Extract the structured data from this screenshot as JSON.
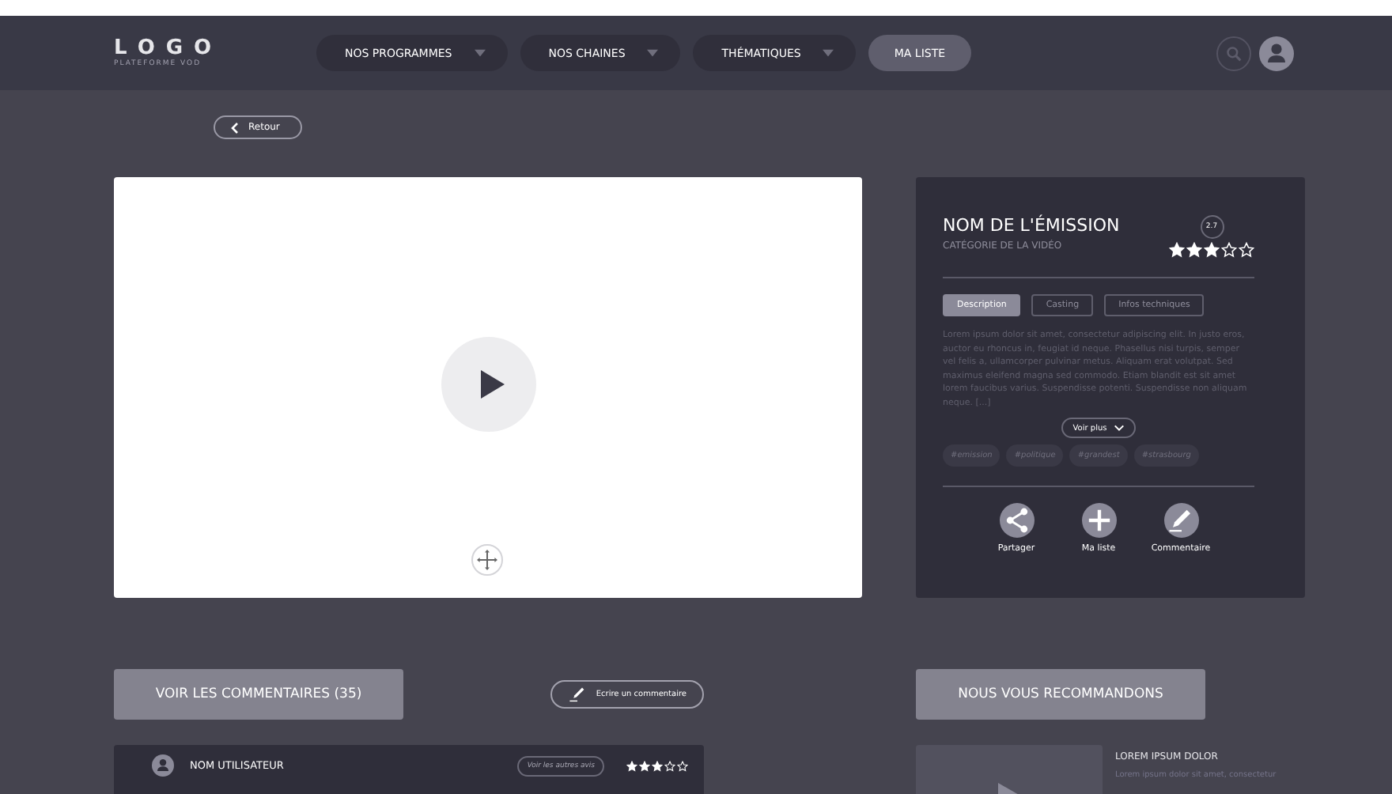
{
  "header": {
    "logo": "LOGO",
    "logo_subtitle": "PLATEFORME VOD",
    "nav": [
      {
        "label": "NOS PROGRAMMES",
        "dropdown": true,
        "selected": false
      },
      {
        "label": "NOS CHAINES",
        "dropdown": true,
        "selected": false
      },
      {
        "label": "THÉMATIQUES",
        "dropdown": true,
        "selected": false
      },
      {
        "label": "MA LISTE",
        "dropdown": false,
        "selected": true
      }
    ]
  },
  "back_button": "Retour",
  "video": {
    "kind": "player"
  },
  "details": {
    "title": "NOM DE L'ÉMISSION",
    "category": "CATÉGORIE DE LA VIDÉO",
    "rating": "2.7",
    "stars": 3,
    "tabs": [
      {
        "label": "Description",
        "selected": true
      },
      {
        "label": "Casting",
        "selected": false
      },
      {
        "label": "Infos techniques",
        "selected": false
      }
    ],
    "description": "Lorem ipsum dolor sit amet, consectetur adipiscing elit. In justo eros, auctor eu rhoncus in, feugiat id neque. Phasellus nisi turpis, semper vel felis a, ullamcorper pulvinar metus. Aliquam erat volutpat. Sed maximus eleifend magna sed commodo. Etiam blandit est sit amet lorem faucibus varius. Suspendisse potenti. Suspendisse non aliquam neque. [...]",
    "more_button": "Voir plus",
    "tags": [
      "#emission",
      "#politique",
      "#grandest",
      "#strasbourg"
    ],
    "actions": [
      {
        "kind": "share",
        "label": "Partager"
      },
      {
        "kind": "add",
        "label": "Ma liste"
      },
      {
        "kind": "comment",
        "label": "Commentaire"
      }
    ]
  },
  "comments": {
    "heading": "VOIR LES COMMENTAIRES (35)",
    "write_button": "Ecrire un commentaire",
    "items": [
      {
        "user": "NOM UTILISATEUR",
        "other_reviews": "Voir les autres avis",
        "stars": 3
      }
    ]
  },
  "recommendations": {
    "heading": "NOUS VOUS RECOMMANDONS",
    "items": [
      {
        "title": "LOREM IPSUM DOLOR",
        "text": "Lorem ipsum dolor sit amet, consectetur"
      }
    ]
  }
}
